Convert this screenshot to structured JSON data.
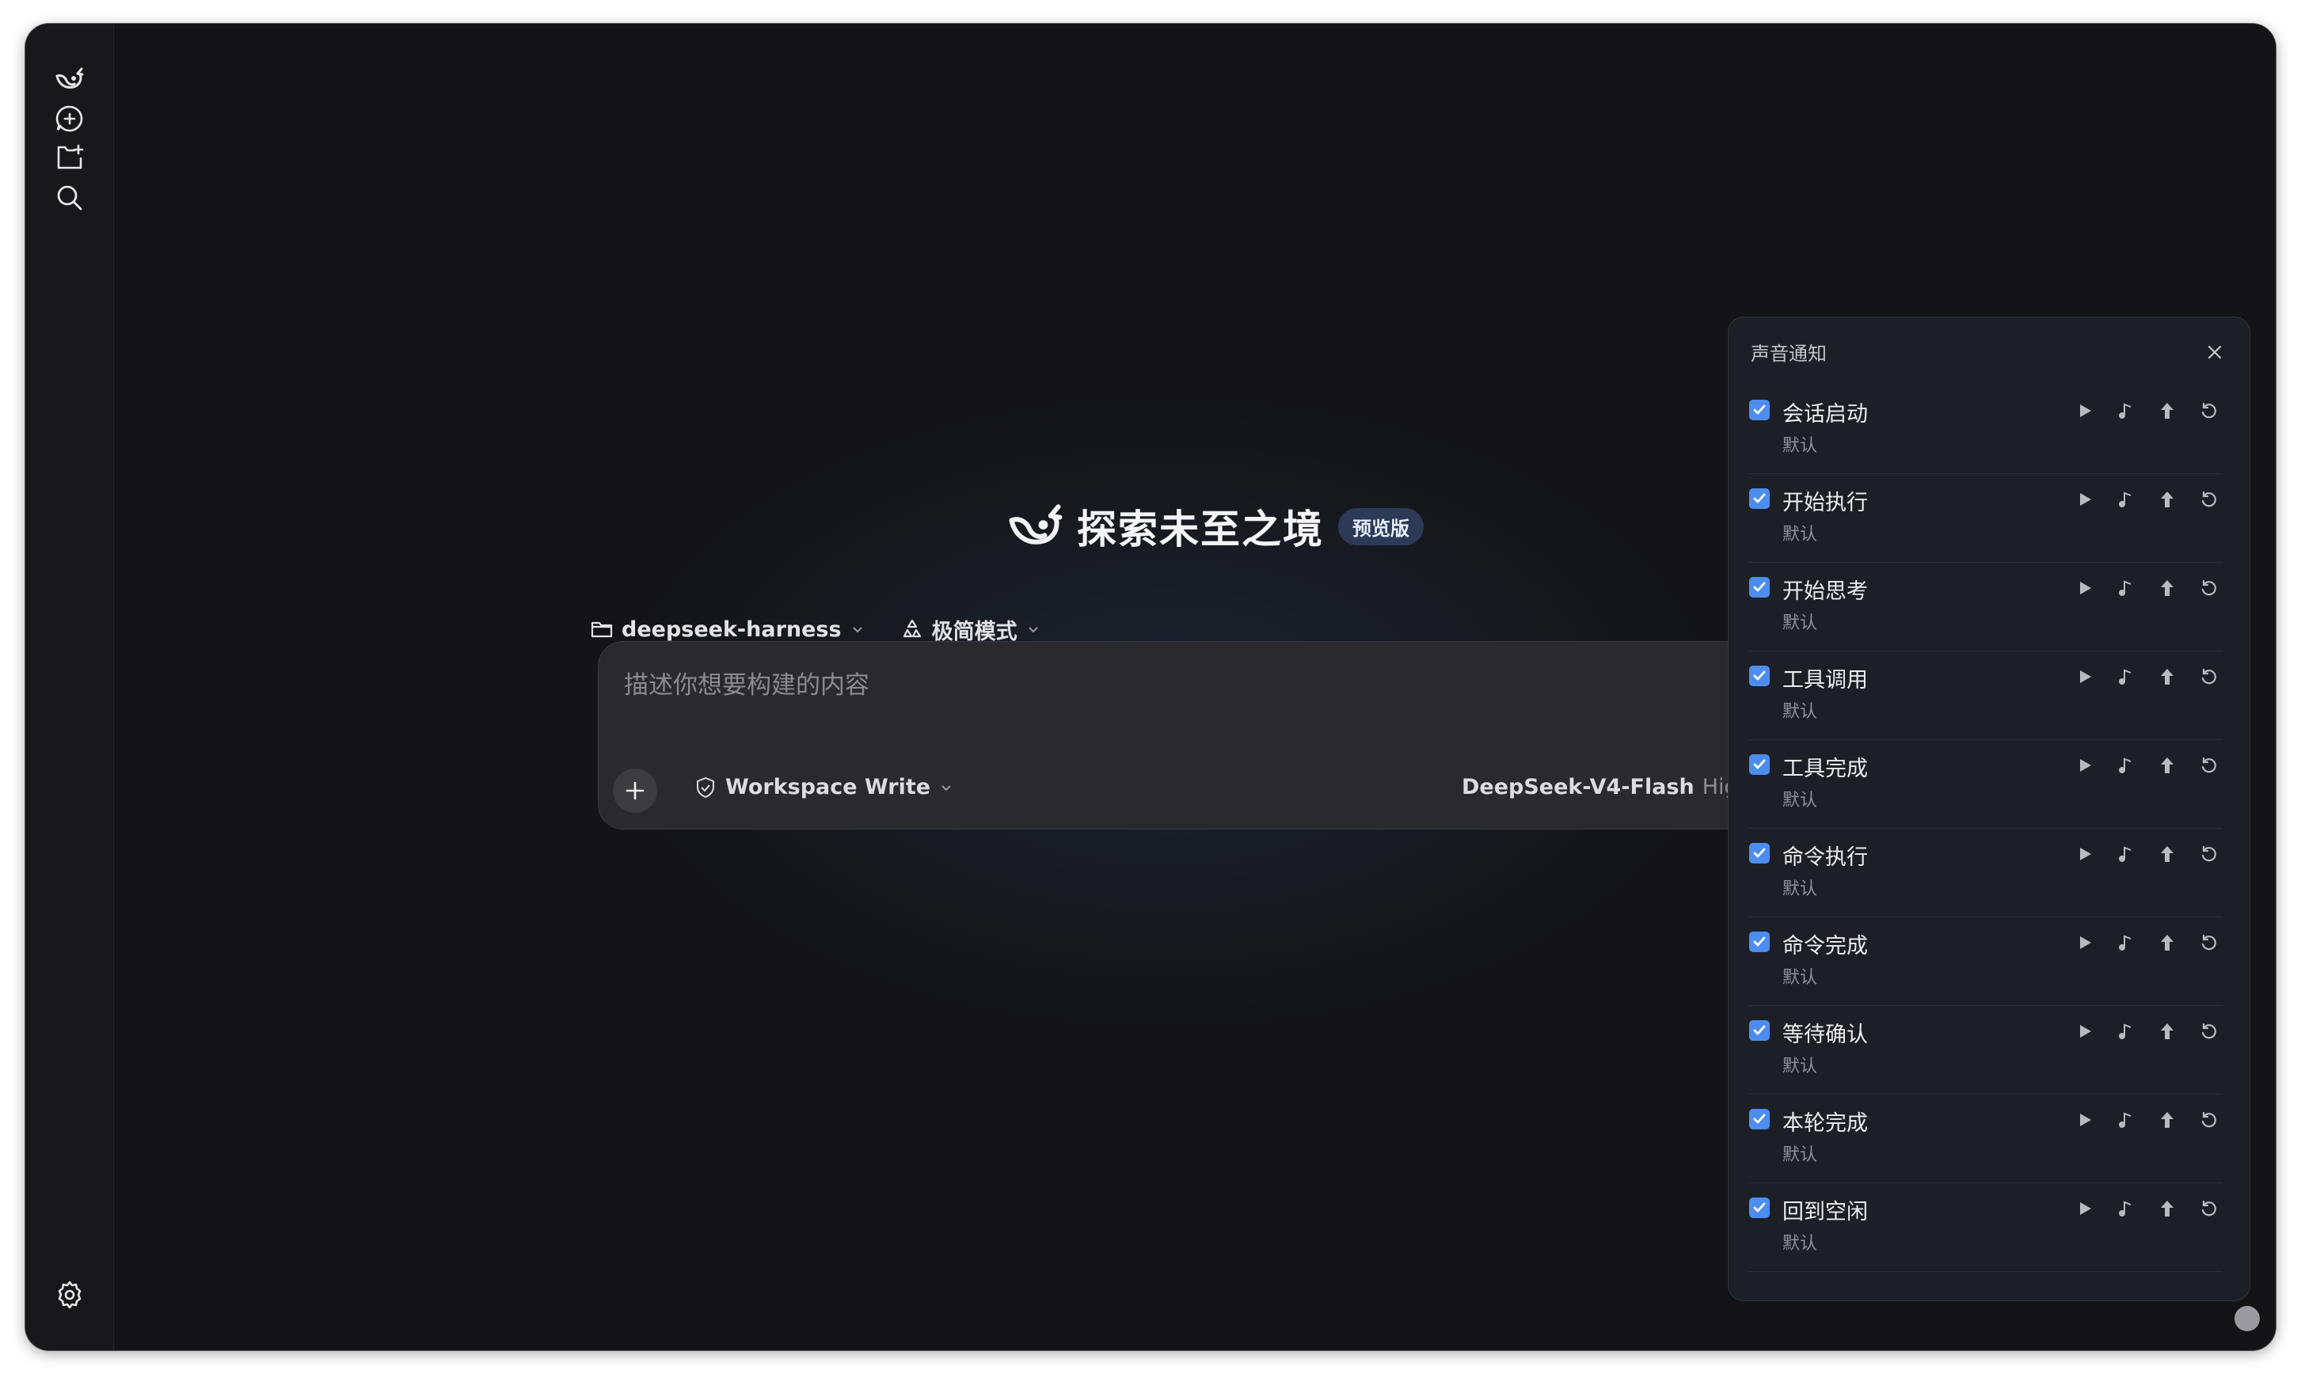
{
  "sidebar": {
    "icons": [
      "whale-logo-icon",
      "new-chat-icon",
      "new-folder-icon",
      "search-icon",
      "settings-icon"
    ]
  },
  "hero": {
    "title": "探索未至之境",
    "badge": "预览版"
  },
  "controls": {
    "project": "deepseek-harness",
    "mode": "极简模式"
  },
  "composer": {
    "placeholder": "描述你想要构建的内容",
    "permission": "Workspace Write",
    "model": "DeepSeek-V4-Flash",
    "effort": "High"
  },
  "panel": {
    "title": "声音通知",
    "items": [
      {
        "name": "会话启动",
        "sub": "默认",
        "checked": true
      },
      {
        "name": "开始执行",
        "sub": "默认",
        "checked": true
      },
      {
        "name": "开始思考",
        "sub": "默认",
        "checked": true
      },
      {
        "name": "工具调用",
        "sub": "默认",
        "checked": true
      },
      {
        "name": "工具完成",
        "sub": "默认",
        "checked": true
      },
      {
        "name": "命令执行",
        "sub": "默认",
        "checked": true
      },
      {
        "name": "命令完成",
        "sub": "默认",
        "checked": true
      },
      {
        "name": "等待确认",
        "sub": "默认",
        "checked": true
      },
      {
        "name": "本轮完成",
        "sub": "默认",
        "checked": true
      },
      {
        "name": "回到空闲",
        "sub": "默认",
        "checked": true
      }
    ]
  },
  "colors": {
    "accent": "#4d8df0",
    "background": "#141416",
    "panel": "#1c1f26",
    "badge": "#2c3a57"
  }
}
